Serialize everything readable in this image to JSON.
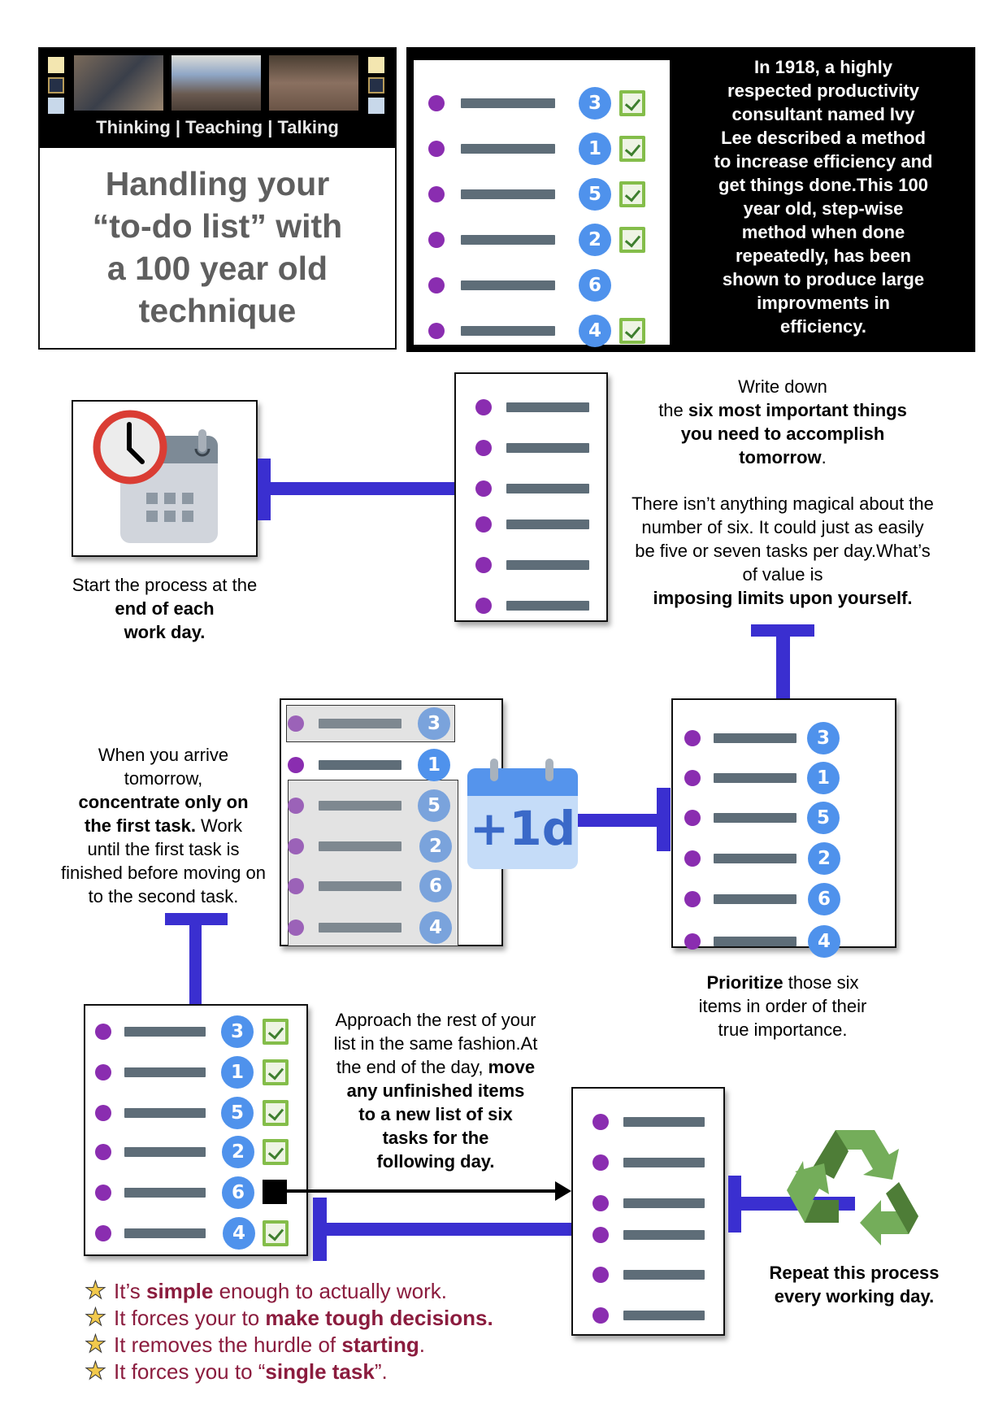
{
  "header": {
    "banner_tagline": "Thinking | Teaching | Talking",
    "title_lines": [
      "Handling your",
      "“to-do list” with",
      "a 100 year old",
      "technique"
    ]
  },
  "intro": {
    "text_lines": [
      "In 1918, a highly",
      "respected productivity",
      "consultant named Ivy",
      "Lee described a method",
      "to increase efficiency and",
      "get things done.This 100",
      "year old, step-wise",
      "method when done",
      "repeatedly, has been",
      "shown to produce large",
      "improvments in",
      "efficiency."
    ],
    "list": [
      {
        "priority": "3",
        "checked": true
      },
      {
        "priority": "1",
        "checked": true
      },
      {
        "priority": "5",
        "checked": true
      },
      {
        "priority": "2",
        "checked": true
      },
      {
        "priority": "6",
        "checked": false
      },
      {
        "priority": "4",
        "checked": true
      }
    ]
  },
  "step1": {
    "icon": "clock-calendar-icon",
    "caption_plain": "Start the process at the",
    "caption_bold_1": "end of each",
    "caption_bold_2": "work day."
  },
  "step2": {
    "line1": "Write down",
    "line2_plain": "the ",
    "line2_bold": "six most important things",
    "line3_bold": "you need to accomplish",
    "line4_bold": "tomorrow",
    "line4_plain": ".",
    "para_lines": [
      "There isn’t anything magical about the",
      "number of six. It could just as easily",
      "be five or seven  tasks per day.What’s",
      "of value is"
    ],
    "para_bold": "imposing limits upon yourself."
  },
  "step3": {
    "bold": "Prioritize",
    "line1_plain": " those six",
    "line2": "items in order of their",
    "line3": "true importance.",
    "list_priorities": [
      "3",
      "1",
      "5",
      "2",
      "6",
      "4"
    ]
  },
  "step4": {
    "calendar_label": "+1d",
    "line1": "When you arrive",
    "line2": "tomorrow,",
    "bold1": "concentrate only on",
    "bold2": "the first task.",
    "plain_after": " Work",
    "line5": "until the first task is",
    "line6": "finished before moving on",
    "line7": "to the second task.",
    "list_priorities": [
      "3",
      "1",
      "5",
      "2",
      "6",
      "4"
    ]
  },
  "step5": {
    "line1": "Approach the rest of your",
    "line2": "list in the same fashion.At",
    "line3_plain": "the end of the day, ",
    "line3_bold": "move",
    "bold_lines": [
      "any unfinished items",
      "to a new list of six",
      "tasks for the",
      "following day."
    ],
    "list": [
      {
        "priority": "3",
        "checked": true
      },
      {
        "priority": "1",
        "checked": true
      },
      {
        "priority": "5",
        "checked": true
      },
      {
        "priority": "2",
        "checked": true
      },
      {
        "priority": "6",
        "checked": false
      },
      {
        "priority": "4",
        "checked": true
      }
    ]
  },
  "step6": {
    "icon": "recycle-icon",
    "line1": "Repeat this process",
    "line2": "every working day."
  },
  "benefits": [
    {
      "pre": "It’s ",
      "bold": "simple",
      "post": " enough to actually work."
    },
    {
      "pre": "It forces your to ",
      "bold": "make tough decisions.",
      "post": ""
    },
    {
      "pre": "It removes the hurdle of ",
      "bold": "starting",
      "post": "."
    },
    {
      "pre": "It forces you to “",
      "bold": "single task",
      "post": "”."
    }
  ],
  "colors": {
    "connector": "#3a2fd0",
    "bullet": "#8a2db0",
    "priority_badge": "#4f92ec",
    "checkbox": "#84bd4a",
    "benefit_text": "#8b1c3e",
    "title_text": "#5f5f5f"
  }
}
